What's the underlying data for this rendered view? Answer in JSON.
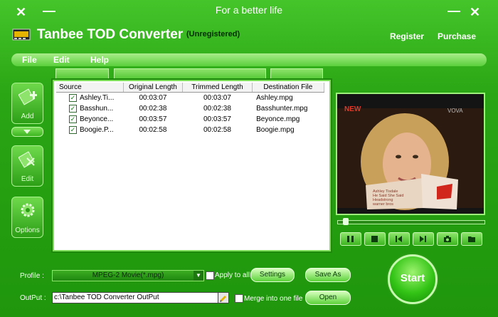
{
  "window": {
    "tagline": "For a better life",
    "title": "Tanbee TOD Converter",
    "status": "(Unregistered)",
    "close_glyph": "✕",
    "minimize_glyph": "—",
    "register_label": "Register",
    "purchase_label": "Purchase"
  },
  "menu": {
    "items": [
      {
        "label": "File"
      },
      {
        "label": "Edit"
      },
      {
        "label": "Help"
      }
    ]
  },
  "sidebar": {
    "items": [
      {
        "label": "Add",
        "icon": "add-icon"
      },
      {
        "label": "Edit",
        "icon": "edit-icon"
      },
      {
        "label": "Options",
        "icon": "gear-icon"
      }
    ]
  },
  "file_list": {
    "columns": [
      "Source",
      "Original Length",
      "Trimmed Length",
      "Destination File"
    ],
    "rows": [
      {
        "checked": true,
        "source": "Ashley.Ti...",
        "original": "00:03:07",
        "trimmed": "00:03:07",
        "destination": "Ashley.mpg"
      },
      {
        "checked": true,
        "source": "Basshun...",
        "original": "00:02:38",
        "trimmed": "00:02:38",
        "destination": "Basshunter.mpg"
      },
      {
        "checked": true,
        "source": "Beyonce...",
        "original": "00:03:57",
        "trimmed": "00:03:57",
        "destination": "Beyonce.mpg"
      },
      {
        "checked": true,
        "source": "Boogie.P...",
        "original": "00:02:58",
        "trimmed": "00:02:58",
        "destination": "Boogie.mpg"
      }
    ]
  },
  "preview": {
    "overlay_brand_left": "NEW",
    "overlay_brand_right": "VOVA",
    "caption_lines": [
      "Ashley Tisdale",
      "He Said She Said",
      "Headstrong",
      "warner bros"
    ],
    "seek_position": 0.04
  },
  "player_controls": [
    {
      "icon": "pause-icon"
    },
    {
      "icon": "stop-icon"
    },
    {
      "icon": "previous-icon"
    },
    {
      "icon": "next-icon"
    },
    {
      "icon": "snapshot-icon"
    },
    {
      "icon": "folder-icon"
    }
  ],
  "bottom": {
    "profile_label": "Profile :",
    "profile_value": "MPEG-2 Movie(*.mpg)",
    "apply_all_label": "Apply to all",
    "settings_label": "Settings",
    "save_as_label": "Save As",
    "output_label": "OutPut :",
    "output_value": "c:\\Tanbee TOD Converter OutPut",
    "merge_label": "Merge into one file",
    "open_label": "Open",
    "start_label": "Start"
  },
  "colors": {
    "accent": "#2aa514",
    "highlight": "#9ef27c"
  }
}
